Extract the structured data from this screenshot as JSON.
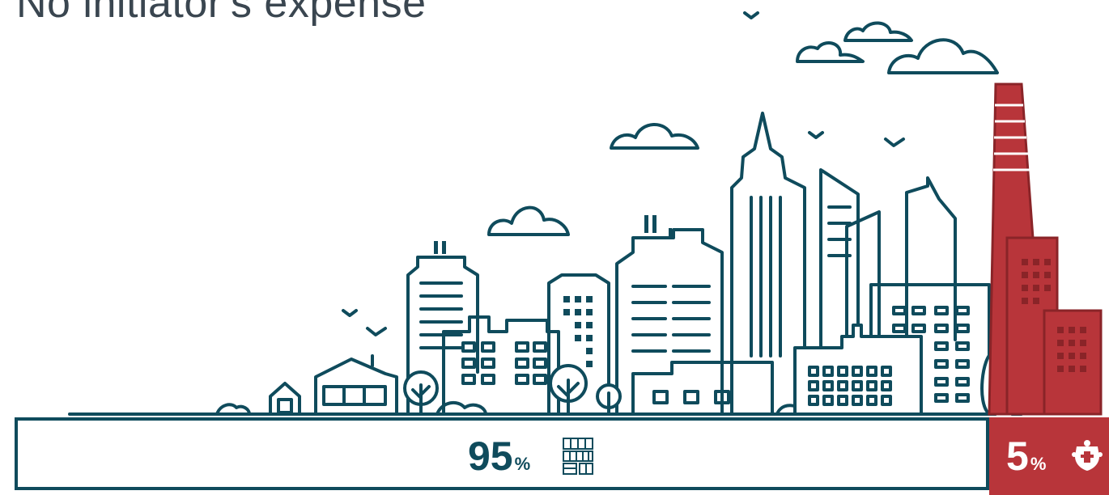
{
  "header": {
    "title": "No initiator's expense"
  },
  "split": {
    "main": {
      "value": "95",
      "symbol": "%",
      "logo": "monogoroda-rf-logo",
      "color": "#0f4b5c"
    },
    "side": {
      "value": "5",
      "symbol": "%",
      "logo": "coat-of-arms-emblem",
      "color": "#b8353a"
    }
  },
  "colors": {
    "outline": "#0f4b5c",
    "accent": "#b8353a",
    "background": "#ffffff"
  }
}
